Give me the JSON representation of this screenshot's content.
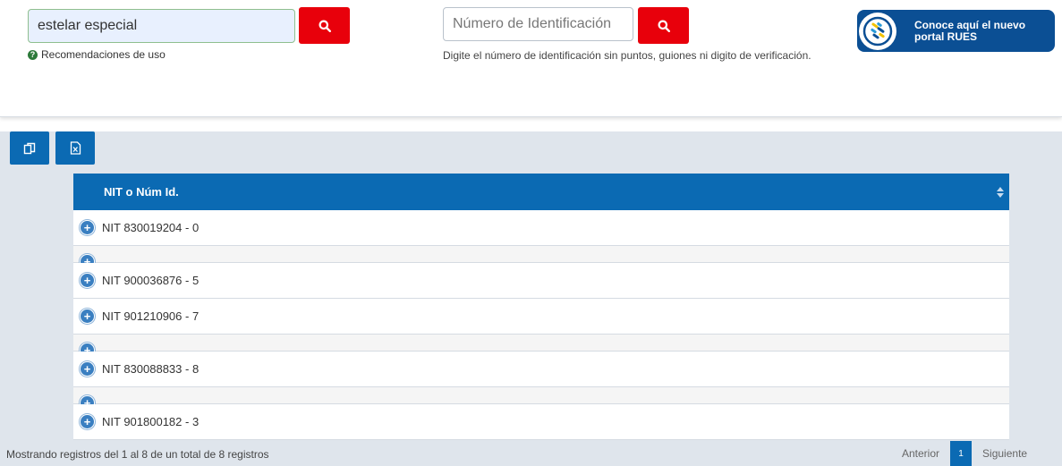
{
  "search": {
    "name_value": "estelar especial",
    "id_placeholder": "Número de Identificación",
    "help_link": "Recomendaciones de uso",
    "id_help": "Digite el número de identificación sin puntos, guiones ni digito de verificación."
  },
  "banner": {
    "line1": "Conoce aquí el nuevo",
    "line2": "portal RUES"
  },
  "table": {
    "header": "NIT o Núm Id.",
    "rows": [
      "NIT 830019204 - 0",
      "NIT 900036876 - 5",
      "NIT 901210906 - 7",
      "NIT 830088833 - 8",
      "NIT 901800182 - 3"
    ]
  },
  "footer": {
    "info": "Mostrando registros del 1 al 8 de un total de 8 registros",
    "prev": "Anterior",
    "page": "1",
    "next": "Siguiente"
  },
  "colors": {
    "primary_blue": "#0b6ab3",
    "search_red": "#e8000b",
    "banner_blue": "#0b4f94"
  },
  "icons": [
    "search-icon",
    "help-icon",
    "copy-icon",
    "excel-icon",
    "sort-icon",
    "expand-icon",
    "rues-logo-icon"
  ]
}
